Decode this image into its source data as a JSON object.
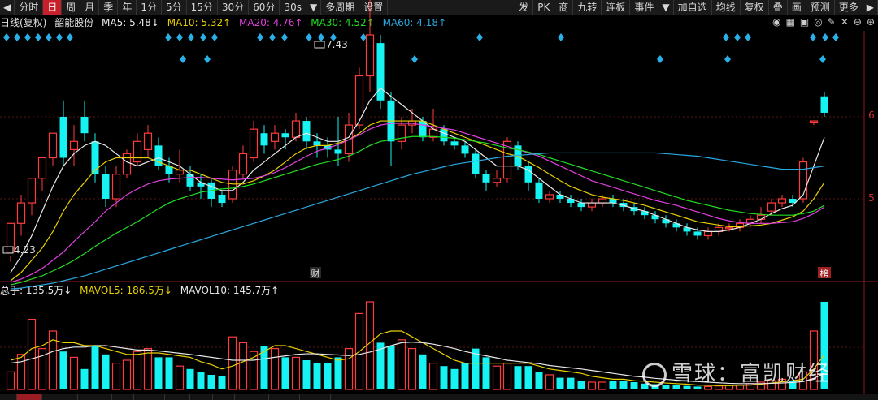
{
  "toolbar": {
    "left_arrow": "◀",
    "periods": [
      "分时",
      "日",
      "周",
      "月",
      "季",
      "年",
      "1分",
      "5分",
      "15分",
      "30分",
      "60分",
      "30s",
      "多周期",
      "设置"
    ],
    "period_dropdown": "▼",
    "right_items": [
      "发",
      "PK",
      "商",
      "九转",
      "连板",
      "事件",
      "加自选",
      "均线",
      "复权",
      "叠",
      "画",
      "预测",
      "更多"
    ],
    "right_dropdown": "▼",
    "right_arrow": "▶"
  },
  "info": {
    "mode": "日线(复权)",
    "stock_name": "韶能股份",
    "ma5_label": "MA5: 5.48↓",
    "ma10_label": "MA10: 5.32↑",
    "ma20_label": "MA20: 4.76↑",
    "ma30_label": "MA30: 4.52↑",
    "ma60_label": "MA60: 4.18↑"
  },
  "axis": {
    "y6": "6",
    "y5": "5"
  },
  "price_chart": {
    "high_label": "7.43",
    "low_label": "4.23",
    "event_cai": "财",
    "event_bang": "榜"
  },
  "volume": {
    "total_label": "总手: 135.5万↓",
    "mavol5_label": "MAVOL5: 186.5万↓",
    "mavol10_label": "MAVOL10: 145.7万↑"
  },
  "watermark": {
    "text": "雪球：富凯财经"
  },
  "colors": {
    "up": "#ff3b3b",
    "down": "#17f2f2",
    "ma5": "#e8e8e8",
    "ma10": "#e8d000",
    "ma20": "#e040e0",
    "ma30": "#22dd22",
    "ma60": "#2aa8e0",
    "bg": "#000000"
  },
  "chart_data": {
    "type": "candlestick",
    "y_range": [
      3.8,
      7.5
    ],
    "ohlc": [
      [
        4.35,
        4.7,
        4.3,
        4.23
      ],
      [
        4.7,
        4.95,
        4.55,
        5.05
      ],
      [
        4.95,
        5.25,
        4.8,
        5.2
      ],
      [
        5.25,
        5.5,
        5.1,
        5.45
      ],
      [
        5.5,
        5.8,
        5.4,
        5.7
      ],
      [
        6.0,
        5.5,
        5.4,
        6.2
      ],
      [
        5.6,
        5.7,
        5.4,
        5.9
      ],
      [
        6.0,
        5.8,
        5.7,
        6.2
      ],
      [
        5.7,
        5.3,
        5.2,
        5.8
      ],
      [
        5.3,
        5.0,
        4.9,
        5.4
      ],
      [
        5.0,
        5.3,
        4.9,
        5.4
      ],
      [
        5.3,
        5.55,
        5.25,
        5.6
      ],
      [
        5.45,
        5.7,
        5.4,
        5.8
      ],
      [
        5.6,
        5.8,
        5.5,
        5.9
      ],
      [
        5.65,
        5.4,
        5.35,
        5.75
      ],
      [
        5.4,
        5.3,
        5.2,
        5.5
      ],
      [
        5.3,
        5.35,
        5.2,
        5.6
      ],
      [
        5.3,
        5.15,
        5.1,
        5.4
      ],
      [
        5.2,
        5.15,
        5.0,
        5.3
      ],
      [
        5.2,
        5.0,
        4.9,
        5.25
      ],
      [
        5.05,
        4.95,
        4.9,
        5.1
      ],
      [
        5.0,
        5.35,
        4.95,
        5.4
      ],
      [
        5.3,
        5.55,
        5.25,
        5.65
      ],
      [
        5.5,
        5.85,
        5.45,
        5.95
      ],
      [
        5.8,
        5.65,
        5.55,
        5.9
      ],
      [
        5.7,
        5.8,
        5.6,
        5.9
      ],
      [
        5.8,
        5.75,
        5.6,
        5.85
      ],
      [
        5.75,
        5.95,
        5.7,
        6.05
      ],
      [
        5.95,
        5.7,
        5.6,
        6.0
      ],
      [
        5.7,
        5.65,
        5.5,
        5.8
      ],
      [
        5.65,
        5.6,
        5.5,
        5.75
      ],
      [
        5.6,
        5.55,
        5.4,
        6.0
      ],
      [
        5.55,
        5.9,
        5.45,
        6.05
      ],
      [
        5.9,
        6.5,
        5.85,
        6.6
      ],
      [
        6.5,
        7.0,
        6.3,
        7.43
      ],
      [
        6.9,
        6.2,
        6.1,
        7.0
      ],
      [
        6.2,
        5.7,
        5.4,
        6.3
      ],
      [
        5.7,
        5.9,
        5.6,
        6.0
      ],
      [
        5.9,
        5.95,
        5.8,
        6.1
      ],
      [
        5.95,
        5.75,
        5.7,
        6.0
      ],
      [
        5.75,
        5.85,
        5.7,
        6.1
      ],
      [
        5.85,
        5.7,
        5.65,
        5.9
      ],
      [
        5.7,
        5.65,
        5.6,
        5.75
      ],
      [
        5.65,
        5.55,
        5.5,
        5.7
      ],
      [
        5.55,
        5.3,
        5.25,
        5.6
      ],
      [
        5.3,
        5.2,
        5.1,
        5.35
      ],
      [
        5.2,
        5.25,
        5.15,
        5.35
      ],
      [
        5.25,
        5.7,
        5.2,
        5.75
      ],
      [
        5.65,
        5.4,
        5.35,
        5.7
      ],
      [
        5.4,
        5.2,
        5.1,
        5.45
      ],
      [
        5.2,
        5.0,
        4.95,
        5.25
      ],
      [
        5.0,
        5.05,
        4.95,
        5.1
      ],
      [
        5.05,
        5.0,
        4.95,
        5.1
      ],
      [
        5.0,
        4.95,
        4.9,
        5.05
      ],
      [
        4.95,
        4.9,
        4.85,
        5.0
      ],
      [
        4.9,
        4.95,
        4.85,
        5.0
      ],
      [
        4.95,
        5.0,
        4.9,
        5.05
      ],
      [
        5.0,
        4.95,
        4.9,
        5.05
      ],
      [
        4.95,
        4.9,
        4.85,
        5.0
      ],
      [
        4.9,
        4.85,
        4.8,
        4.95
      ],
      [
        4.85,
        4.8,
        4.75,
        4.9
      ],
      [
        4.8,
        4.75,
        4.7,
        4.85
      ],
      [
        4.75,
        4.7,
        4.65,
        4.8
      ],
      [
        4.7,
        4.65,
        4.6,
        4.75
      ],
      [
        4.65,
        4.6,
        4.55,
        4.7
      ],
      [
        4.6,
        4.55,
        4.5,
        4.65
      ],
      [
        4.55,
        4.6,
        4.5,
        4.65
      ],
      [
        4.6,
        4.65,
        4.55,
        4.7
      ],
      [
        4.65,
        4.65,
        4.6,
        4.7
      ],
      [
        4.65,
        4.7,
        4.6,
        4.75
      ],
      [
        4.7,
        4.75,
        4.65,
        4.8
      ],
      [
        4.75,
        4.8,
        4.7,
        4.9
      ],
      [
        4.85,
        4.95,
        4.8,
        5.0
      ],
      [
        4.95,
        5.0,
        4.9,
        5.05
      ],
      [
        5.0,
        4.95,
        4.9,
        5.05
      ],
      [
        5.0,
        5.45,
        4.95,
        5.5
      ],
      [
        5.95,
        5.95,
        5.9,
        5.95
      ],
      [
        6.25,
        6.05,
        6.0,
        6.3
      ]
    ],
    "ma5": [
      4.1,
      4.3,
      4.55,
      4.85,
      5.15,
      5.4,
      5.55,
      5.65,
      5.7,
      5.65,
      5.55,
      5.45,
      5.4,
      5.45,
      5.5,
      5.45,
      5.4,
      5.3,
      5.2,
      5.15,
      5.1,
      5.1,
      5.2,
      5.35,
      5.45,
      5.55,
      5.65,
      5.75,
      5.8,
      5.75,
      5.7,
      5.7,
      5.75,
      5.95,
      6.2,
      6.35,
      6.25,
      6.15,
      6.05,
      5.95,
      5.85,
      5.8,
      5.75,
      5.7,
      5.6,
      5.5,
      5.4,
      5.4,
      5.4,
      5.35,
      5.25,
      5.15,
      5.05,
      5.0,
      4.95,
      4.95,
      4.95,
      4.95,
      4.92,
      4.88,
      4.85,
      4.8,
      4.75,
      4.7,
      4.65,
      4.62,
      4.6,
      4.6,
      4.62,
      4.65,
      4.7,
      4.75,
      4.82,
      4.88,
      4.92,
      5.05,
      5.4,
      5.75
    ],
    "ma10": [
      4.0,
      4.1,
      4.25,
      4.4,
      4.6,
      4.85,
      5.05,
      5.2,
      5.35,
      5.45,
      5.5,
      5.5,
      5.5,
      5.5,
      5.45,
      5.4,
      5.35,
      5.35,
      5.3,
      5.25,
      5.2,
      5.18,
      5.18,
      5.22,
      5.28,
      5.35,
      5.45,
      5.55,
      5.62,
      5.65,
      5.65,
      5.68,
      5.72,
      5.8,
      5.9,
      5.95,
      5.95,
      5.95,
      5.95,
      5.95,
      5.9,
      5.85,
      5.8,
      5.75,
      5.7,
      5.65,
      5.6,
      5.55,
      5.52,
      5.45,
      5.38,
      5.3,
      5.22,
      5.15,
      5.1,
      5.05,
      5.02,
      5.0,
      4.98,
      4.95,
      4.92,
      4.88,
      4.84,
      4.8,
      4.76,
      4.72,
      4.7,
      4.68,
      4.66,
      4.66,
      4.67,
      4.68,
      4.7,
      4.74,
      4.78,
      4.85,
      5.0,
      5.2
    ],
    "ma20": [
      3.98,
      4.02,
      4.08,
      4.15,
      4.25,
      4.35,
      4.48,
      4.6,
      4.72,
      4.85,
      4.95,
      5.05,
      5.12,
      5.18,
      5.22,
      5.24,
      5.25,
      5.26,
      5.26,
      5.25,
      5.24,
      5.23,
      5.24,
      5.25,
      5.28,
      5.32,
      5.38,
      5.45,
      5.52,
      5.58,
      5.62,
      5.66,
      5.72,
      5.78,
      5.85,
      5.9,
      5.92,
      5.92,
      5.92,
      5.9,
      5.88,
      5.86,
      5.84,
      5.8,
      5.76,
      5.72,
      5.68,
      5.64,
      5.6,
      5.56,
      5.52,
      5.46,
      5.4,
      5.34,
      5.28,
      5.22,
      5.18,
      5.14,
      5.1,
      5.06,
      5.02,
      4.98,
      4.95,
      4.92,
      4.88,
      4.84,
      4.8,
      4.76,
      4.73,
      4.71,
      4.7,
      4.7,
      4.7,
      4.71,
      4.72,
      4.76,
      4.82,
      4.9
    ],
    "ma30": [
      3.95,
      3.98,
      4.02,
      4.06,
      4.12,
      4.18,
      4.25,
      4.33,
      4.42,
      4.5,
      4.58,
      4.65,
      4.72,
      4.8,
      4.88,
      4.95,
      5.0,
      5.04,
      5.08,
      5.1,
      5.12,
      5.13,
      5.15,
      5.18,
      5.22,
      5.26,
      5.3,
      5.34,
      5.38,
      5.42,
      5.45,
      5.48,
      5.52,
      5.58,
      5.65,
      5.7,
      5.72,
      5.74,
      5.76,
      5.76,
      5.76,
      5.75,
      5.74,
      5.72,
      5.7,
      5.68,
      5.65,
      5.62,
      5.6,
      5.57,
      5.54,
      5.5,
      5.46,
      5.42,
      5.38,
      5.34,
      5.3,
      5.26,
      5.22,
      5.18,
      5.14,
      5.1,
      5.06,
      5.02,
      4.98,
      4.95,
      4.92,
      4.89,
      4.86,
      4.84,
      4.82,
      4.81,
      4.8,
      4.8,
      4.8,
      4.82,
      4.85,
      4.92
    ],
    "ma60": [
      3.9,
      3.91,
      3.93,
      3.95,
      3.97,
      4.0,
      4.03,
      4.06,
      4.1,
      4.14,
      4.18,
      4.22,
      4.26,
      4.3,
      4.34,
      4.38,
      4.42,
      4.46,
      4.5,
      4.54,
      4.58,
      4.62,
      4.66,
      4.7,
      4.74,
      4.78,
      4.82,
      4.86,
      4.9,
      4.94,
      4.98,
      5.02,
      5.06,
      5.1,
      5.14,
      5.18,
      5.22,
      5.26,
      5.3,
      5.33,
      5.36,
      5.39,
      5.42,
      5.44,
      5.46,
      5.48,
      5.5,
      5.52,
      5.53,
      5.54,
      5.55,
      5.56,
      5.56,
      5.56,
      5.56,
      5.56,
      5.56,
      5.56,
      5.56,
      5.56,
      5.56,
      5.56,
      5.55,
      5.54,
      5.53,
      5.52,
      5.5,
      5.48,
      5.46,
      5.44,
      5.42,
      5.4,
      5.38,
      5.36,
      5.36,
      5.36,
      5.38,
      5.4
    ],
    "volume": [
      60,
      120,
      240,
      140,
      200,
      130,
      110,
      70,
      150,
      120,
      90,
      100,
      130,
      140,
      110,
      110,
      80,
      70,
      60,
      50,
      45,
      180,
      160,
      130,
      150,
      140,
      110,
      110,
      100,
      90,
      90,
      110,
      140,
      260,
      300,
      160,
      150,
      170,
      140,
      120,
      90,
      80,
      70,
      90,
      140,
      110,
      80,
      90,
      80,
      80,
      60,
      50,
      40,
      40,
      30,
      25,
      25,
      30,
      30,
      25,
      20,
      18,
      15,
      15,
      12,
      10,
      10,
      12,
      15,
      15,
      20,
      25,
      30,
      35,
      30,
      60,
      200,
      300
    ],
    "mavol5": [
      100,
      110,
      140,
      150,
      170,
      160,
      160,
      150,
      150,
      140,
      130,
      120,
      120,
      125,
      125,
      120,
      115,
      110,
      95,
      85,
      70,
      80,
      95,
      110,
      130,
      150,
      150,
      140,
      130,
      120,
      110,
      100,
      105,
      130,
      160,
      190,
      200,
      200,
      180,
      160,
      140,
      120,
      100,
      90,
      90,
      90,
      90,
      90,
      90,
      90,
      80,
      70,
      65,
      60,
      55,
      45,
      40,
      35,
      35,
      30,
      28,
      25,
      22,
      20,
      18,
      15,
      14,
      13,
      13,
      14,
      15,
      18,
      22,
      26,
      30,
      35,
      70,
      120
    ],
    "mavol10": [
      90,
      95,
      105,
      115,
      130,
      140,
      145,
      145,
      150,
      150,
      145,
      140,
      135,
      135,
      132,
      128,
      124,
      120,
      115,
      110,
      105,
      100,
      100,
      100,
      105,
      110,
      115,
      120,
      122,
      122,
      120,
      118,
      116,
      120,
      128,
      138,
      150,
      160,
      162,
      160,
      155,
      148,
      140,
      130,
      122,
      115,
      108,
      100,
      96,
      92,
      88,
      82,
      78,
      74,
      70,
      65,
      60,
      55,
      50,
      45,
      42,
      38,
      35,
      32,
      29,
      27,
      25,
      23,
      21,
      20,
      20,
      20,
      21,
      22,
      24,
      27,
      38,
      55
    ],
    "vol_max": 300
  }
}
